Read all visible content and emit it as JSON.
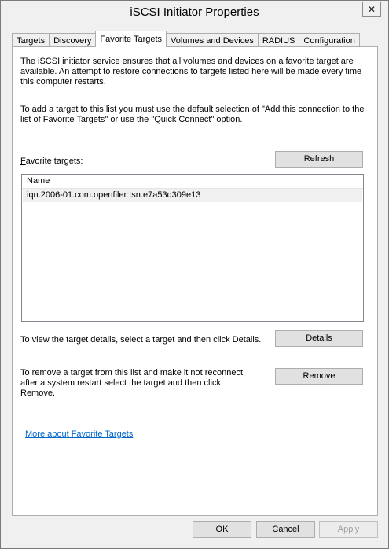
{
  "window": {
    "title": "iSCSI Initiator Properties",
    "close_glyph": "✕"
  },
  "tabs": [
    {
      "label": "Targets",
      "active": false
    },
    {
      "label": "Discovery",
      "active": false
    },
    {
      "label": "Favorite Targets",
      "active": true
    },
    {
      "label": "Volumes and Devices",
      "active": false
    },
    {
      "label": "RADIUS",
      "active": false
    },
    {
      "label": "Configuration",
      "active": false
    }
  ],
  "panel": {
    "intro_text": "The iSCSI initiator service ensures that all volumes and devices on a favorite target are available.  An attempt to restore connections to targets listed here will be made every time this computer restarts.",
    "add_text": "To add a target to this list you must use the default selection of \"Add this connection to the list of Favorite Targets\" or use the \"Quick Connect\" option.",
    "favorites_label": "Favorite targets:",
    "refresh_label": "Refresh",
    "list": {
      "column_header": "Name",
      "rows": [
        "iqn.2006-01.com.openfiler:tsn.e7a53d309e13"
      ]
    },
    "details_text": "To view the target details, select a target and then click Details.",
    "details_label": "Details",
    "remove_text": "To remove a target from this list and make it not reconnect after a system restart select the target and then click Remove.",
    "remove_label": "Remove",
    "more_link": "More about Favorite Targets"
  },
  "footer": {
    "ok_label": "OK",
    "cancel_label": "Cancel",
    "apply_label": "Apply"
  },
  "colors": {
    "link": "#0066cc",
    "selected_row": "#f0f0f0"
  },
  "icons": {
    "close": "close-icon"
  }
}
